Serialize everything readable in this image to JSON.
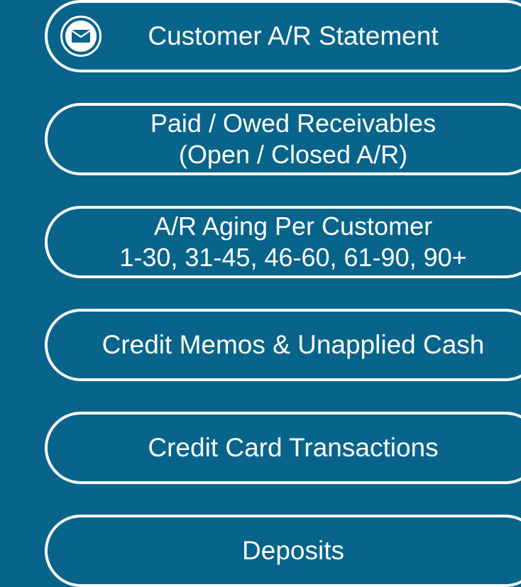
{
  "menu": {
    "items": [
      {
        "id": "customer-ar-statement",
        "line1": "Customer A/R Statement",
        "icon": "envelope-icon"
      },
      {
        "id": "paid-owed-receivables",
        "line1": "Paid / Owed Receivables",
        "line2": "(Open / Closed A/R)"
      },
      {
        "id": "ar-aging-per-customer",
        "line1": "A/R Aging Per Customer",
        "line2": "1-30, 31-45, 46-60, 61-90, 90+"
      },
      {
        "id": "credit-memos-unapplied-cash",
        "line1": "Credit Memos & Unapplied Cash"
      },
      {
        "id": "credit-card-transactions",
        "line1": "Credit Card Transactions"
      },
      {
        "id": "deposits",
        "line1": "Deposits"
      }
    ]
  },
  "colors": {
    "background": "#08648a",
    "foreground": "#ffffff"
  }
}
